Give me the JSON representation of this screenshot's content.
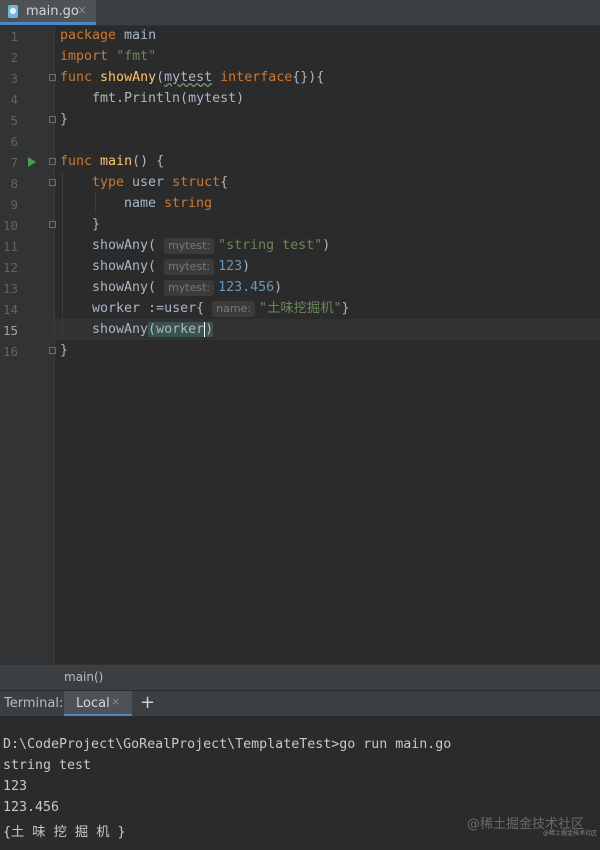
{
  "tab": {
    "filename": "main.go",
    "close": "×",
    "icon": "go-file-icon"
  },
  "line_numbers": [
    "1",
    "2",
    "3",
    "4",
    "5",
    "6",
    "7",
    "8",
    "9",
    "10",
    "11",
    "12",
    "13",
    "14",
    "15",
    "16"
  ],
  "code": {
    "l1_kw": "package",
    "l1_rest": " main",
    "l2_kw": "import",
    "l2_str": "\"fmt\"",
    "l3_kw": "func",
    "l3_fn": "showAny",
    "l3_open": "(",
    "l3_param": "mytest",
    "l3_kw2": "interface",
    "l3_rest": "{}){",
    "l4_text": "fmt.Println(mytest)",
    "l5_text": "}",
    "l7_kw": "func",
    "l7_fn": "main",
    "l7_rest": "() {",
    "l8_kw": "type",
    "l8_mid": " user ",
    "l8_kw2": "struct",
    "l8_rest": "{",
    "l9_name": "name ",
    "l9_type": "string",
    "l10_text": "}",
    "l11_call": "showAny(",
    "l11_hint": "mytest:",
    "l11_str": "\"string test\"",
    "l11_close": ")",
    "l12_call": "showAny(",
    "l12_hint": "mytest:",
    "l12_num": "123",
    "l12_close": ")",
    "l13_call": "showAny(",
    "l13_hint": "mytest:",
    "l13_num": "123.456",
    "l13_close": ")",
    "l14_var": "worker",
    "l14_op": " :=user{",
    "l14_hint": "name:",
    "l14_str": "\"土味挖掘机\"",
    "l14_close": "}",
    "l15_call": "showAny",
    "l15_open": "(",
    "l15_arg": "worker",
    "l15_close": ")",
    "l16_text": "}"
  },
  "breadcrumb": "main()",
  "terminal": {
    "title": "Terminal:",
    "tab_label": "Local",
    "tab_close": "×",
    "new_tab": "+",
    "lines": [
      "D:\\CodeProject\\GoRealProject\\TemplateTest>go run main.go",
      "string test",
      "123",
      "123.456",
      "{土 味 挖 掘 机 }"
    ]
  },
  "watermark": "@稀土掘金技术社区",
  "watermark_small": "@稀土掘金技术社区"
}
